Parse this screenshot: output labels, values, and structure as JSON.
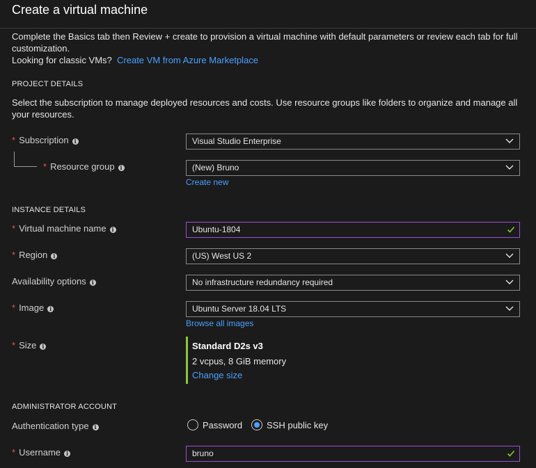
{
  "header": {
    "title": "Create a virtual machine"
  },
  "intro": {
    "text": "Complete the Basics tab then Review + create to provision a virtual machine with default parameters or review each tab for full customization.",
    "classic_prefix": "Looking for classic VMs?",
    "classic_link": "Create VM from Azure Marketplace"
  },
  "project": {
    "title": "PROJECT DETAILS",
    "description": "Select the subscription to manage deployed resources and costs. Use resource groups like folders to organize and manage all your resources.",
    "subscription": {
      "label": "Subscription",
      "value": "Visual Studio Enterprise"
    },
    "resource_group": {
      "label": "Resource group",
      "value": "(New) Bruno",
      "create_link": "Create new"
    }
  },
  "instance": {
    "title": "INSTANCE DETAILS",
    "vm_name": {
      "label": "Virtual machine name",
      "value": "Ubuntu-1804"
    },
    "region": {
      "label": "Region",
      "value": "(US) West US 2"
    },
    "availability": {
      "label": "Availability options",
      "value": "No infrastructure redundancy required"
    },
    "image": {
      "label": "Image",
      "value": "Ubuntu Server 18.04 LTS",
      "browse_link": "Browse all images"
    },
    "size": {
      "label": "Size",
      "name": "Standard D2s v3",
      "spec": "2 vcpus, 8 GiB memory",
      "change_link": "Change size"
    }
  },
  "admin": {
    "title": "ADMINISTRATOR ACCOUNT",
    "auth_type": {
      "label": "Authentication type",
      "options": [
        "Password",
        "SSH public key"
      ],
      "selected": "SSH public key"
    },
    "username": {
      "label": "Username",
      "value": "bruno"
    }
  },
  "symbols": {
    "required": "*",
    "info": "i"
  },
  "colors": {
    "background": "#1b1b1b",
    "link": "#4aa0ff",
    "required": "#e0554e",
    "valid_border": "#a04ed8",
    "valid_check": "#8dc63f",
    "size_accent": "#8dc63f"
  }
}
